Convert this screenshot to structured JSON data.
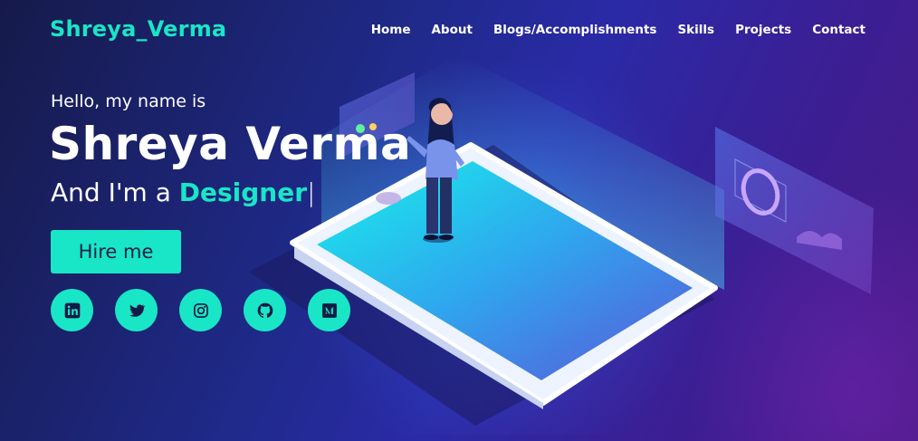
{
  "brand": {
    "logo_text": "Shreya_Verma"
  },
  "nav": {
    "items": [
      {
        "label": "Home"
      },
      {
        "label": "About"
      },
      {
        "label": "Blogs/Accomplishments"
      },
      {
        "label": "Skills"
      },
      {
        "label": "Projects"
      },
      {
        "label": "Contact"
      }
    ]
  },
  "hero": {
    "greeting": "Hello, my name is",
    "name": "Shreya Verma",
    "role_prefix": "And I'm a ",
    "role": "Designer",
    "cursor": "|",
    "cta_label": "Hire me"
  },
  "socials": [
    {
      "icon": "linkedin-icon"
    },
    {
      "icon": "twitter-icon"
    },
    {
      "icon": "instagram-icon"
    },
    {
      "icon": "github-icon"
    },
    {
      "icon": "medium-icon"
    }
  ],
  "colors": {
    "accent": "#19e6c6",
    "background_start": "#161a4a",
    "background_end": "#4a1b86",
    "text": "#ffffff"
  }
}
